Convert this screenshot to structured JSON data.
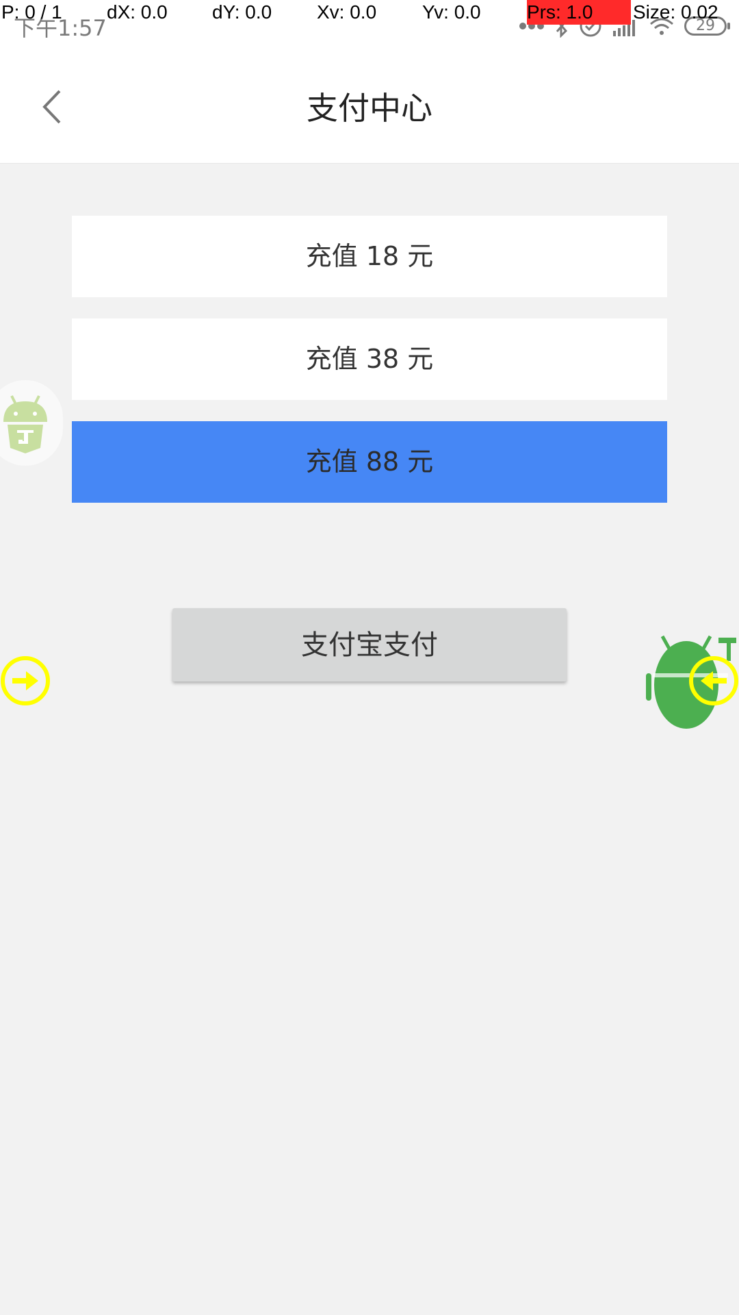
{
  "status_bar": {
    "time": "下午1:57",
    "battery_level": "29"
  },
  "pointer_overlay": {
    "p": "P: 0 / 1",
    "dx": "dX: 0.0",
    "dy": "dY: 0.0",
    "xv": "Xv: 0.0",
    "yv": "Yv: 0.0",
    "prs": "Prs: 1.0",
    "size": "Size: 0.02"
  },
  "header": {
    "back_icon": "chevron-left",
    "title": "支付中心"
  },
  "recharge_options": [
    {
      "label": "充值 18 元",
      "selected": false
    },
    {
      "label": "充值 38 元",
      "selected": false
    },
    {
      "label": "充值 88 元",
      "selected": true
    }
  ],
  "pay_button": {
    "label": "支付宝支付"
  },
  "colors": {
    "selected_option": "#4687f5",
    "background": "#f2f2f2",
    "pay_button": "#d6d7d7",
    "overlay_yellow": "#ffff00",
    "android_green": "#4caf50"
  }
}
